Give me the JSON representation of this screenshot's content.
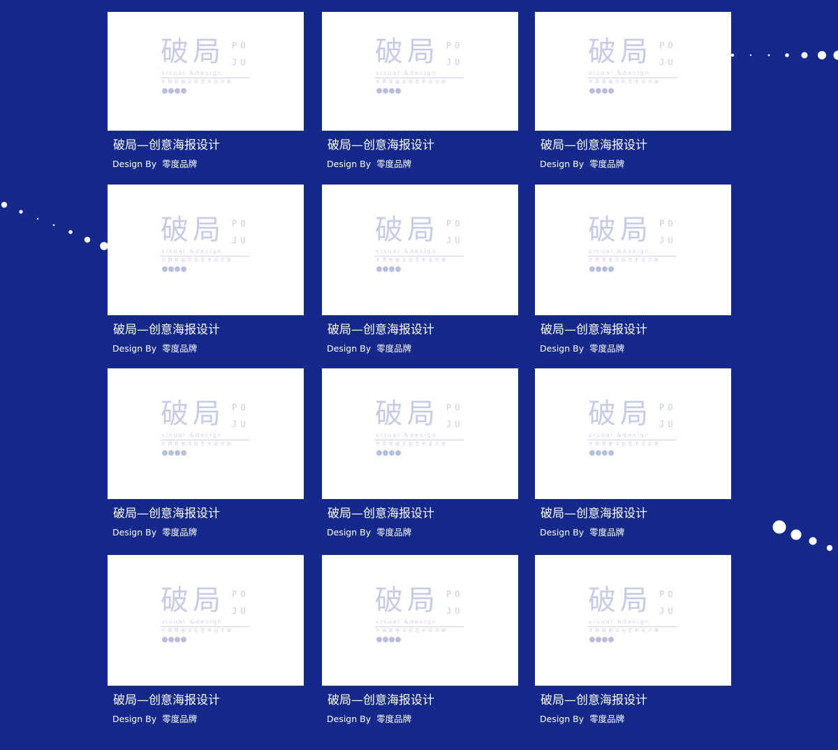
{
  "colors": {
    "background": "#14298a",
    "thumbnail": "#ffffff",
    "logo_mark": "#c7cbe4",
    "text": "#ffffff"
  },
  "logo": {
    "mark_cn": "破局",
    "mark_en": "PO\nJU",
    "subtitle": "visual &design",
    "tagline": "许昌首届文化艺术设计周",
    "dot_icon": "circle-dot-icon"
  },
  "gallery": {
    "columns": 3,
    "rows": 4,
    "items": [
      {
        "title": "破局—创意海报设计",
        "credit_label": "Design By",
        "author": "零度品牌"
      },
      {
        "title": "破局—创意海报设计",
        "credit_label": "Design By",
        "author": "零度品牌"
      },
      {
        "title": "破局—创意海报设计",
        "credit_label": "Design By",
        "author": "零度品牌"
      },
      {
        "title": "破局—创意海报设计",
        "credit_label": "Design By",
        "author": "零度品牌"
      },
      {
        "title": "破局—创意海报设计",
        "credit_label": "Design By",
        "author": "零度品牌"
      },
      {
        "title": "破局—创意海报设计",
        "credit_label": "Design By",
        "author": "零度品牌"
      },
      {
        "title": "破局—创意海报设计",
        "credit_label": "Design By",
        "author": "零度品牌"
      },
      {
        "title": "破局—创意海报设计",
        "credit_label": "Design By",
        "author": "零度品牌"
      },
      {
        "title": "破局—创意海报设计",
        "credit_label": "Design By",
        "author": "零度品牌"
      },
      {
        "title": "破局—创意海报设计",
        "credit_label": "Design By",
        "author": "零度品牌"
      },
      {
        "title": "破局—创意海报设计",
        "credit_label": "Design By",
        "author": "零度品牌"
      },
      {
        "title": "破局—创意海报设计",
        "credit_label": "Design By",
        "author": "零度品牌"
      }
    ]
  }
}
